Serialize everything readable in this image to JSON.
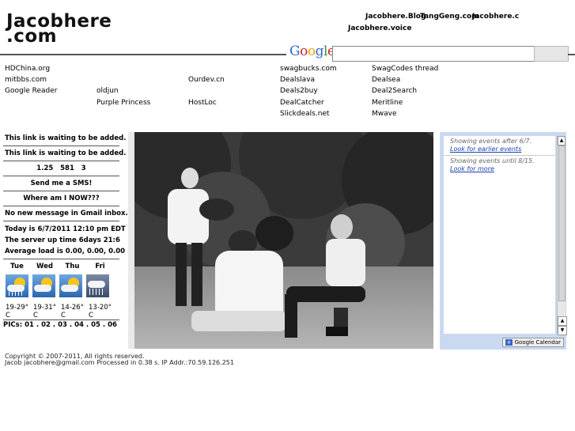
{
  "logo": {
    "line1": "Jacobhere",
    "line2": ".com"
  },
  "top_links": {
    "row1": [
      "Jacobhere.Blog",
      "TangGeng.com",
      "Jacobhere.c"
    ],
    "row2": "Jacobhere.voice"
  },
  "search": {
    "brand": "Google",
    "value": "",
    "button_label": ""
  },
  "links": {
    "col1": [
      "HDChina.org",
      "mitbbs.com",
      "Google Reader"
    ],
    "col2": [
      "oldjun",
      "Purple Princess"
    ],
    "col3": [
      "Ourdev.cn",
      "HostLoc"
    ],
    "col4": [
      "swagbucks.com",
      "Dealslava",
      "Deals2buy",
      "DealCatcher",
      "Slickdeals.net"
    ],
    "col5": [
      "SwagCodes thread",
      "Dealsea",
      "Deal2Search",
      "Meritline",
      "Mwave"
    ]
  },
  "left_panel": {
    "link1": "This link is waiting to be added.",
    "link2": "This link is waiting to be added.",
    "counter": "1.25   581   3",
    "sms": "Send me a SMS!",
    "where": "Where am I NOW???",
    "gmail": "No new message in Gmail inbox.",
    "today": "Today is 6/7/2011 12:10 pm EDT",
    "uptime": "The server up time 6days 21:6",
    "load": "Average load is 0.00, 0.00, 0.00",
    "days": [
      "Tue",
      "Wed",
      "Thu",
      "Fri"
    ],
    "weather_icons": [
      "partly-cloudy-rain-icon",
      "partly-cloudy-icon",
      "partly-cloudy-icon",
      "rain-icon"
    ],
    "temps": [
      "19-29° C",
      "19-31° C",
      "14-26° C",
      "13-20° C"
    ],
    "pics_label": "PICs:",
    "pics": [
      "01",
      "02",
      "03",
      "04",
      "05",
      "06"
    ]
  },
  "calendar": {
    "after": "Showing events after 6/7.",
    "earlier_link": "Look for earlier events",
    "until": "Showing events until 8/15.",
    "more_link": "Look for more",
    "badge": "Google Calendar"
  },
  "footer": {
    "copyright": "Copyright © 2007-2011, All rights reserved.",
    "line2": "Jacob jacobhere@gmail.com   Processed in 0.38 s.   IP Addr.:70.59.126.251"
  },
  "colors": {
    "google_blue": "#3366cc",
    "google_red": "#cc2222",
    "google_yellow": "#e6a800",
    "google_green": "#2a9a3a",
    "calendar_bg": "#c9d9ef",
    "link_blue": "#1a3fb0"
  }
}
